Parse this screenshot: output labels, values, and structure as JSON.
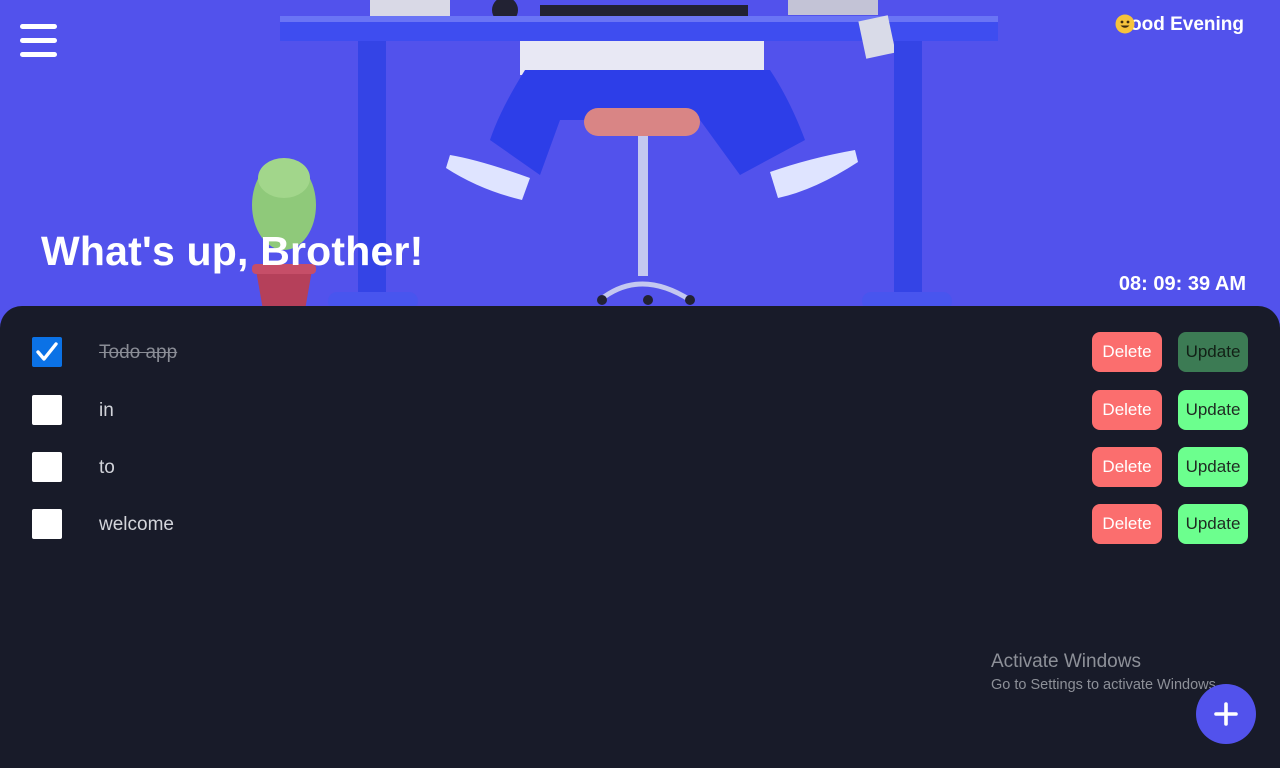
{
  "header": {
    "greeting": "Good Evening",
    "headline": "What's up, Brother!",
    "clock": "08: 09: 39 AM"
  },
  "todos": [
    {
      "text": "Todo app",
      "completed": true
    },
    {
      "text": "in",
      "completed": false
    },
    {
      "text": "to",
      "completed": false
    },
    {
      "text": "welcome",
      "completed": false
    }
  ],
  "buttons": {
    "delete_label": "Delete",
    "update_label": "Update"
  },
  "watermark": {
    "title": "Activate Windows",
    "subtitle": "Go to Settings to activate Windows."
  },
  "icons": {
    "menu": "hamburger-menu-icon",
    "greeting": "grinning-face-icon",
    "add": "plus-icon",
    "check": "checkmark-icon"
  },
  "colors": {
    "accent": "#5252ec",
    "panel": "#181b29",
    "delete": "#fb6e6e",
    "update": "#6cff8e",
    "checkbox_checked": "#0b72e6"
  }
}
